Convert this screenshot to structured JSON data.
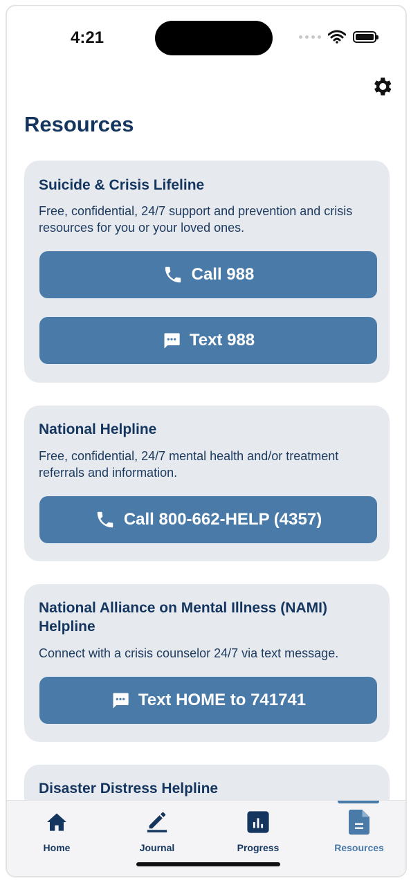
{
  "status_bar": {
    "time": "4:21"
  },
  "header": {
    "title": "Resources",
    "settings_icon": "gear-icon"
  },
  "cards": [
    {
      "title": "Suicide & Crisis Lifeline",
      "description": "Free, confidential, 24/7 support and prevention and crisis resources for you or your loved ones.",
      "buttons": [
        {
          "label": "Call 988",
          "icon": "phone-icon"
        },
        {
          "label": "Text 988",
          "icon": "message-icon"
        }
      ]
    },
    {
      "title": "National Helpline",
      "description": "Free, confidential, 24/7 mental health and/or treatment referrals and information.",
      "buttons": [
        {
          "label": "Call 800-662-HELP (4357)",
          "icon": "phone-icon"
        }
      ]
    },
    {
      "title": "National Alliance on Mental Illness (NAMI) Helpline",
      "description": "Connect with a crisis counselor 24/7 via text message.",
      "buttons": [
        {
          "label": "Text HOME to 741741",
          "icon": "message-icon"
        }
      ]
    },
    {
      "title": "Disaster Distress Helpline"
    }
  ],
  "tab_bar": {
    "tabs": [
      {
        "label": "Home",
        "icon": "home-icon"
      },
      {
        "label": "Journal",
        "icon": "pencil-icon"
      },
      {
        "label": "Progress",
        "icon": "chart-icon"
      },
      {
        "label": "Resources",
        "icon": "document-icon"
      }
    ],
    "active": "Resources"
  },
  "colors": {
    "title": "#14355e",
    "card_bg": "#e6e9ee",
    "button": "#4a7aa7",
    "active_tab": "#4a7aa7"
  }
}
